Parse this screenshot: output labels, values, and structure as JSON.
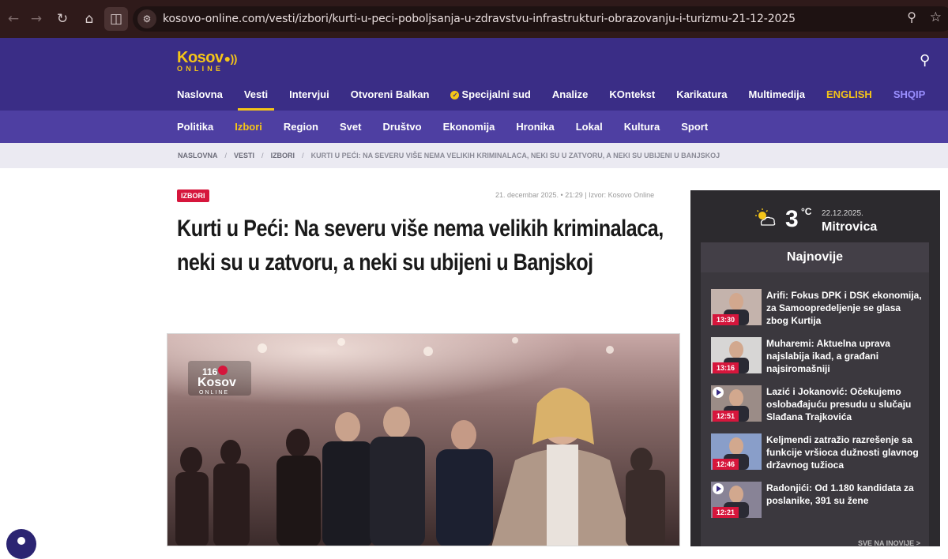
{
  "browser": {
    "url": "kosovo-online.com/vesti/izbori/kurti-u-peci-poboljsanja-u-zdravstvu-infrastrukturi-obrazovanju-i-turizmu-21-12-2025",
    "icons": [
      "back-icon",
      "forward-icon",
      "reload-icon",
      "home-icon",
      "split-view-icon",
      "site-info-icon",
      "zoom-icon",
      "bookmark-star-icon"
    ]
  },
  "logo": {
    "main": "Kosov",
    "sub": "ONLINE"
  },
  "main_nav": [
    "Naslovna",
    "Vesti",
    "Intervjui",
    "Otvoreni Balkan",
    "Specijalni sud",
    "Analize",
    "KOntekst",
    "Karikatura",
    "Multimedija",
    "ENGLISH",
    "SHQIP"
  ],
  "main_nav_active": "Vesti",
  "sub_nav": [
    "Politika",
    "Izbori",
    "Region",
    "Svet",
    "Društvo",
    "Ekonomija",
    "Hronika",
    "Lokal",
    "Kultura",
    "Sport"
  ],
  "sub_nav_active": "Izbori",
  "breadcrumb": {
    "home": "NASLOVNA",
    "section": "VESTI",
    "category": "IZBORI",
    "current": "KURTI U PEĆI: NA SEVERU VIŠE NEMA VELIKIH KRIMINALACA, NEKI SU U ZATVORU, A NEKI SU UBIJENI U BANJSKOJ"
  },
  "article": {
    "tag": "IZBORI",
    "meta": "21. decembar 2025. • 21:29  |  Izvor: Kosovo Online",
    "title": "Kurti u Peći: Na severu više nema velikih kriminalaca, neki su u zatvoru, a neki su ubijeni u Banjskoj",
    "image_watermark": {
      "badge": "116",
      "main": "Kosov",
      "sub": "ONLINE"
    }
  },
  "weather": {
    "icon": "partly-cloudy-icon",
    "temp": "3",
    "unit": "°C",
    "date": "22.12.2025.",
    "city": "Mitrovica"
  },
  "latest": {
    "title": "Najnovije",
    "items": [
      {
        "time": "13:30",
        "title": "Arifi: Fokus DPK i DSK ekonomija, za Samoopredeljenje se glasa zbog Kurtija",
        "video": false
      },
      {
        "time": "13:16",
        "title": "Muharemi: Aktuelna uprava najslabija ikad, a građani najsiromašniji",
        "video": false
      },
      {
        "time": "12:51",
        "title": "Lazić i Jokanović: Očekujemo oslobađajuću presudu u slučaju Slađana Trajkovića",
        "video": true
      },
      {
        "time": "12:46",
        "title": "Keljmendi zatražio razrešenje sa funkcije vršioca dužnosti glavnog državnog tužioca",
        "video": false
      },
      {
        "time": "12:21",
        "title": "Radonjići: Od 1.180 kandidata za poslanike, 391 su žene",
        "video": true
      }
    ],
    "more": "SVE NA INOVIJE >"
  }
}
